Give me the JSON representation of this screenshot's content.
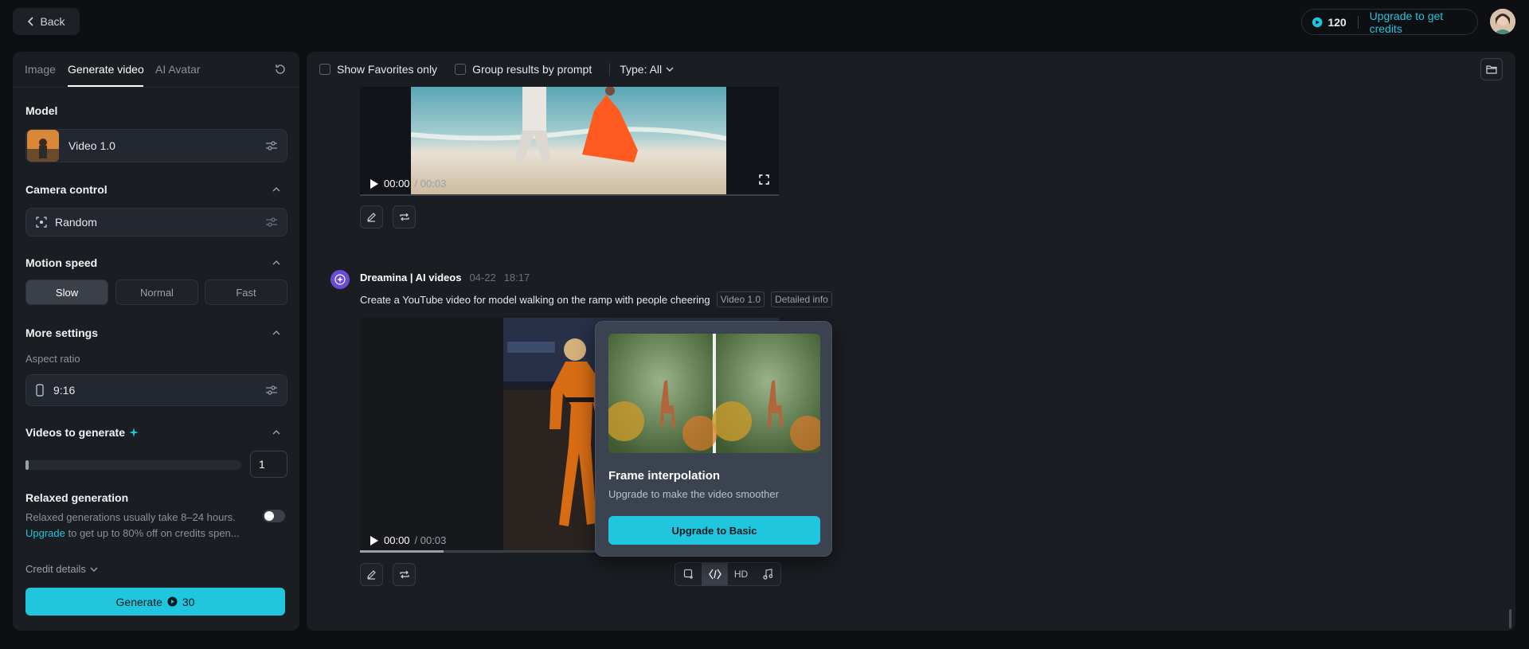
{
  "topbar": {
    "back_label": "Back",
    "credits": "120",
    "upgrade_label": "Upgrade to get credits"
  },
  "left": {
    "tabs": [
      {
        "label": "Image"
      },
      {
        "label": "Generate video"
      },
      {
        "label": "AI Avatar"
      }
    ],
    "model_title": "Model",
    "model_value": "Video 1.0",
    "camera_title": "Camera control",
    "camera_value": "Random",
    "motion_title": "Motion speed",
    "motion_options": [
      {
        "label": "Slow"
      },
      {
        "label": "Normal"
      },
      {
        "label": "Fast"
      }
    ],
    "motion_selected": "Slow",
    "more_title": "More settings",
    "aspect_label": "Aspect ratio",
    "aspect_value": "9:16",
    "videos_title": "Videos to generate",
    "videos_count": "1",
    "relaxed_title": "Relaxed generation",
    "relaxed_line1": "Relaxed generations usually take 8–24 hours.",
    "relaxed_link": "Upgrade",
    "relaxed_line2": " to get up to 80% off on credits spen...",
    "credit_details": "Credit details",
    "generate_label": "Generate",
    "generate_cost": "30"
  },
  "main": {
    "filters": {
      "favorites": "Show Favorites only",
      "group": "Group results by prompt",
      "type": "Type: All"
    },
    "video1": {
      "time": "00:00",
      "duration": " / 00:03"
    },
    "generation": {
      "name": "Dreamina | AI videos",
      "date": "04-22",
      "time": "18:17",
      "prompt": "Create a YouTube video for model walking on the ramp with people cheering",
      "model_tag": "Video 1.0",
      "info_tag": "Detailed info"
    },
    "video2": {
      "time": "00:00",
      "duration": " / 00:03",
      "progress": 0.2
    },
    "tools": {
      "hd_label": "HD"
    },
    "popover": {
      "title": "Frame interpolation",
      "subtitle": "Upgrade to make the video smoother",
      "button": "Upgrade to Basic"
    }
  },
  "colors": {
    "accent": "#1fc6dd",
    "panel": "#1a1d22",
    "background": "#0e0f12"
  }
}
